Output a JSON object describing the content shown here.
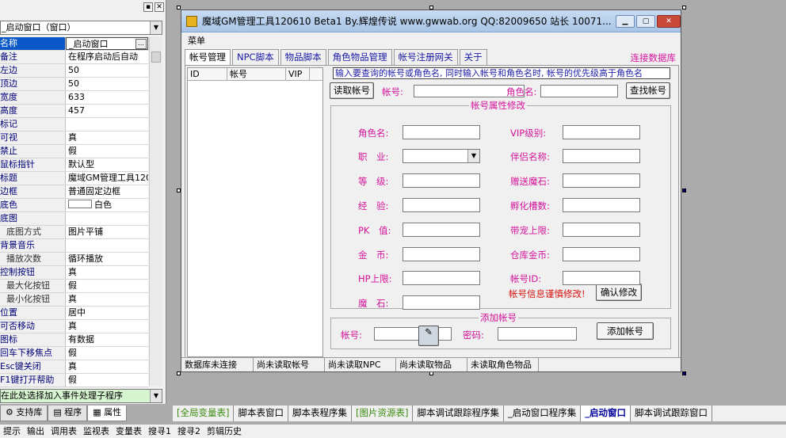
{
  "left_panel": {
    "top_buttons": [
      "▪",
      "✕"
    ],
    "object_combo": "_启动窗口（窗口）",
    "properties": [
      {
        "name": "名称",
        "value": "_启动窗口",
        "selected": true
      },
      {
        "name": "备注",
        "value": "在程序启动后自动"
      },
      {
        "name": "左边",
        "value": "50"
      },
      {
        "name": "顶边",
        "value": "50"
      },
      {
        "name": "宽度",
        "value": "633"
      },
      {
        "name": "高度",
        "value": "457"
      },
      {
        "name": "标记",
        "value": ""
      },
      {
        "name": "可视",
        "value": "真"
      },
      {
        "name": "禁止",
        "value": "假"
      },
      {
        "name": "鼠标指针",
        "value": "默认型"
      },
      {
        "name": "标题",
        "value": "魔域GM管理工具120"
      },
      {
        "name": "边框",
        "value": "普通固定边框"
      },
      {
        "name": "底色",
        "value": "白色",
        "color": true
      },
      {
        "name": "底图",
        "value": ""
      },
      {
        "name": "底图方式",
        "value": "图片平铺",
        "sub": true
      },
      {
        "name": "背景音乐",
        "value": ""
      },
      {
        "name": "播放次数",
        "value": "循环播放",
        "sub": true
      },
      {
        "name": "控制按钮",
        "value": "真"
      },
      {
        "name": "最大化按钮",
        "value": "假",
        "sub": true
      },
      {
        "name": "最小化按钮",
        "value": "真",
        "sub": true
      },
      {
        "name": "位置",
        "value": "居中"
      },
      {
        "name": "可否移动",
        "value": "真"
      },
      {
        "name": "图标",
        "value": "有数据"
      },
      {
        "name": "回车下移焦点",
        "value": "假"
      },
      {
        "name": "Esc键关闭",
        "value": "真"
      },
      {
        "name": "F1键打开帮助",
        "value": "假"
      }
    ],
    "event_combo": "在此处选择加入事件处理子程序",
    "tabs": [
      "支持库",
      "程序",
      "属性"
    ],
    "active_tab": "属性"
  },
  "window": {
    "title": "魔域GM管理工具120610 Beta1 By.辉煌传说 www.gwwab.org QQ:82009650 站长 10071...",
    "menu": "菜单",
    "tabs": [
      "帐号管理",
      "NPC脚本",
      "物品脚本",
      "角色物品管理",
      "帐号注册网关",
      "关于"
    ],
    "active_tab": "帐号管理",
    "connect_link": "连接数据库",
    "list_columns": [
      "ID",
      "帐号",
      "VIP"
    ],
    "hint": "输入要查询的帐号或角色名, 同时输入帐号和角色名时, 帐号的优先级高于角色名",
    "read_account_btn": "读取帐号",
    "account_label": "帐号:",
    "role_label": "角色名:",
    "find_account_btn": "查找帐号",
    "props_group_title": "帐号属性修改",
    "left_fields": [
      "角色名:",
      "职　业:",
      "等　级:",
      "经　验:",
      "PK　值:",
      "金　币:",
      "HP上限:",
      "魔　石:"
    ],
    "right_fields": [
      "VIP级别:",
      "伴侣名称:",
      "赠送魔石:",
      "孵化槽数:",
      "带宠上限:",
      "仓库金币:",
      "帐号ID:"
    ],
    "warning": "帐号信息谨慎修改!",
    "confirm_btn": "确认修改",
    "add_group_title": "添加帐号",
    "add_account_label": "帐号:",
    "add_password_label": "密码:",
    "add_account_btn": "添加帐号",
    "status": [
      "数据库未连接",
      "尚未读取帐号",
      "尚未读取NPC",
      "尚未读取物品",
      "未读取角色物品"
    ]
  },
  "doc_tabs": [
    {
      "label": "[全局变量表]",
      "green": true
    },
    {
      "label": "脚本表窗口"
    },
    {
      "label": "脚本表程序集"
    },
    {
      "label": "[图片资源表]",
      "green": true
    },
    {
      "label": "脚本调试跟踪程序集"
    },
    {
      "label": "_启动窗口程序集"
    },
    {
      "label": "_启动窗口",
      "active": true
    },
    {
      "label": "脚本调试跟踪窗口"
    }
  ],
  "bottom_bar": [
    "提示",
    "输出",
    "调用表",
    "监视表",
    "变量表",
    "搜寻1",
    "搜寻2",
    "剪辑历史"
  ],
  "colors": {
    "accent_pink": "#d4139b",
    "link_blue": "#1a1aa6",
    "selection": "#0a58c8",
    "warning_red": "#d81010"
  }
}
